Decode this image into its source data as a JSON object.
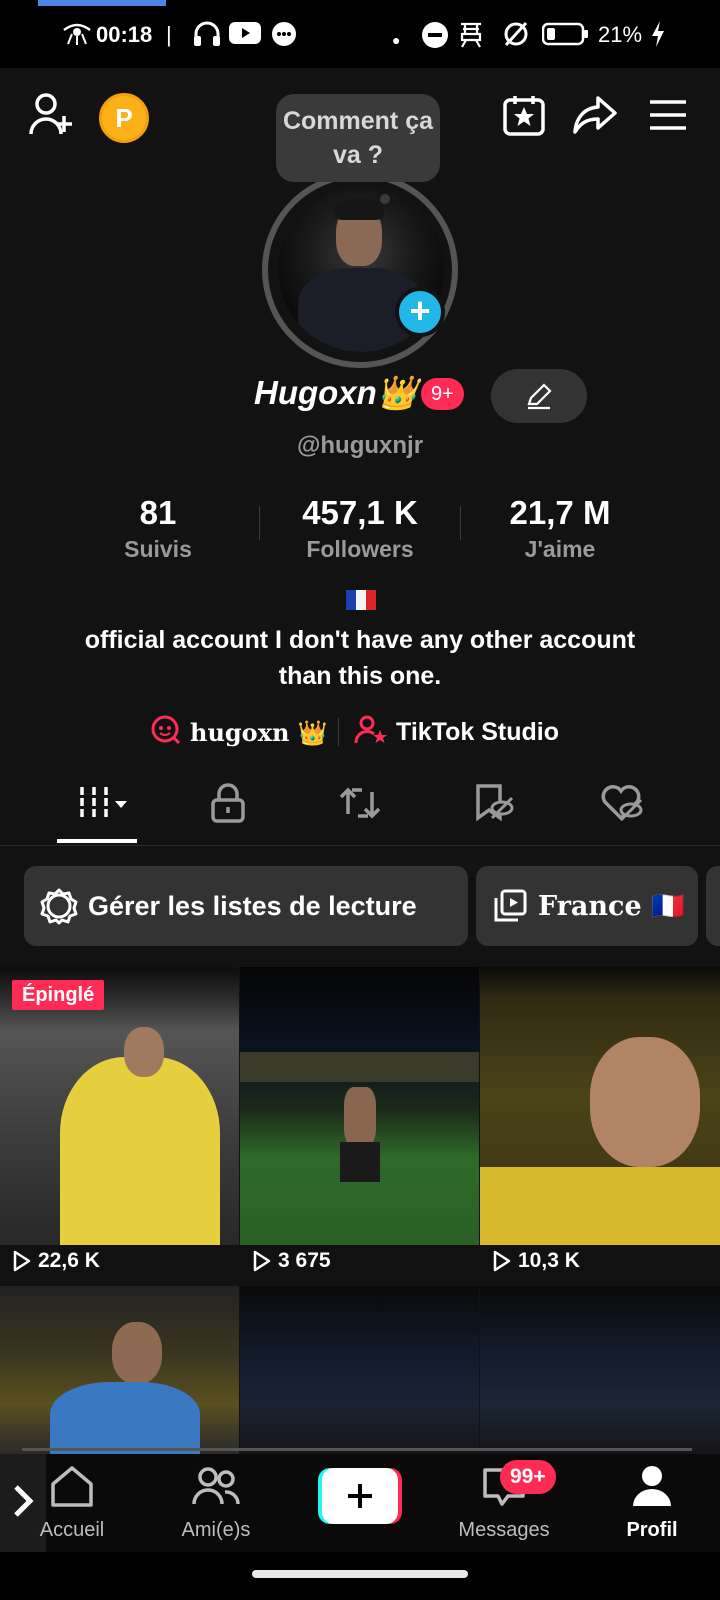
{
  "status_bar": {
    "time": "00:18",
    "battery": "21%"
  },
  "top_bar": {
    "coin_letter": "P",
    "speech_bubble": "Comment ça va ?"
  },
  "profile": {
    "display_name": "Hugoxn👑",
    "notification_count": "9+",
    "handle": "@huguxnjr",
    "stats": [
      {
        "value": "81",
        "label": "Suivis"
      },
      {
        "value": "457,1 K",
        "label": "Followers"
      },
      {
        "value": "21,7 M",
        "label": "J'aime"
      }
    ],
    "flag_emoji": "🇫🇷",
    "bio": "official account I don't have any other account than this one.",
    "links": [
      {
        "label": "hugoxn 👑"
      },
      {
        "label": "TikTok Studio"
      }
    ]
  },
  "chips": [
    {
      "label": "Gérer les listes de lecture"
    },
    {
      "label": "France 🇫🇷"
    }
  ],
  "videos": [
    {
      "views": "22,6 K",
      "pinned_label": "Épinglé"
    },
    {
      "views": "3 675"
    },
    {
      "views": "10,3 K"
    },
    {
      "views": ""
    },
    {
      "views": ""
    },
    {
      "views": ""
    }
  ],
  "bottom_nav": {
    "items": [
      {
        "label": "Accueil"
      },
      {
        "label": "Ami(e)s"
      },
      {
        "label": ""
      },
      {
        "label": "Messages"
      },
      {
        "label": "Profil"
      }
    ],
    "messages_badge": "99+"
  },
  "colors": {
    "accent_red": "#fe2c55",
    "accent_cyan": "#22b7e8",
    "coin_gold": "#ffb019",
    "background": "#121212"
  }
}
